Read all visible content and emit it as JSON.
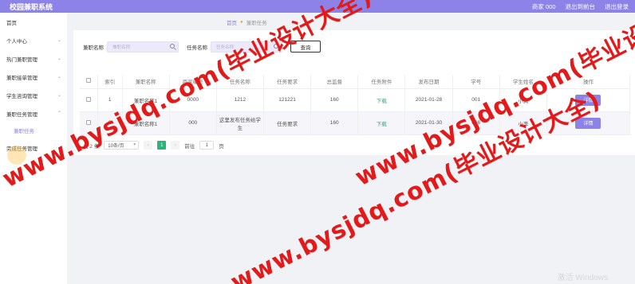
{
  "header": {
    "title": "校园兼职系统",
    "user": "商家 000",
    "back_to_front": "退出到前台",
    "logout": "退出登录"
  },
  "sidebar": {
    "items": [
      {
        "label": "首页",
        "has_chevron": false
      },
      {
        "label": "个人中心",
        "has_chevron": true
      },
      {
        "label": "热门兼职管理",
        "has_chevron": true
      },
      {
        "label": "兼职接单管理",
        "has_chevron": true
      },
      {
        "label": "学生咨询管理",
        "has_chevron": true
      },
      {
        "label": "兼职任务管理",
        "has_chevron": true
      }
    ],
    "sub_item": "兼职任务",
    "last_item": "完成任务管理"
  },
  "breadcrumb": {
    "home": "首页",
    "current": "兼职任务"
  },
  "search": {
    "field1_label": "兼职名称",
    "field1_placeholder": "兼职名称",
    "field2_label": "任务名称",
    "field2_placeholder": "任务名称",
    "button": "查询"
  },
  "table": {
    "headers": [
      "",
      "索引",
      "兼职名称",
      "商家编号",
      "任务名称",
      "任务要求",
      "总监督",
      "任务附件",
      "发布日期",
      "学号",
      "学生姓名",
      "操作"
    ],
    "rows": [
      {
        "index": "1",
        "job": "兼职名称1",
        "merchant": "0000",
        "task": "1212",
        "req": "121221",
        "total": "160",
        "file": "下载",
        "date": "2021-01-28",
        "sid": "001",
        "sname": "小黄",
        "action": "详情"
      },
      {
        "index": "2",
        "job": "兼职名称1",
        "merchant": "000",
        "task": "这里发布任务给学生",
        "req": "任务要求",
        "total": "160",
        "file": "下载",
        "date": "2021-01-30",
        "sid": "666",
        "sname": "小李",
        "action": "详情"
      }
    ]
  },
  "pager": {
    "total": "共 2 条",
    "size": "10条/页",
    "prev": "‹",
    "page": "1",
    "next": "›",
    "goto": "前往",
    "goto_value": "1",
    "page_unit": "页"
  },
  "watermark": {
    "text": "www.bysjdq.com(毕业设计大全)",
    "color": "#e21a1a"
  },
  "faint_text": "激活 Windows"
}
